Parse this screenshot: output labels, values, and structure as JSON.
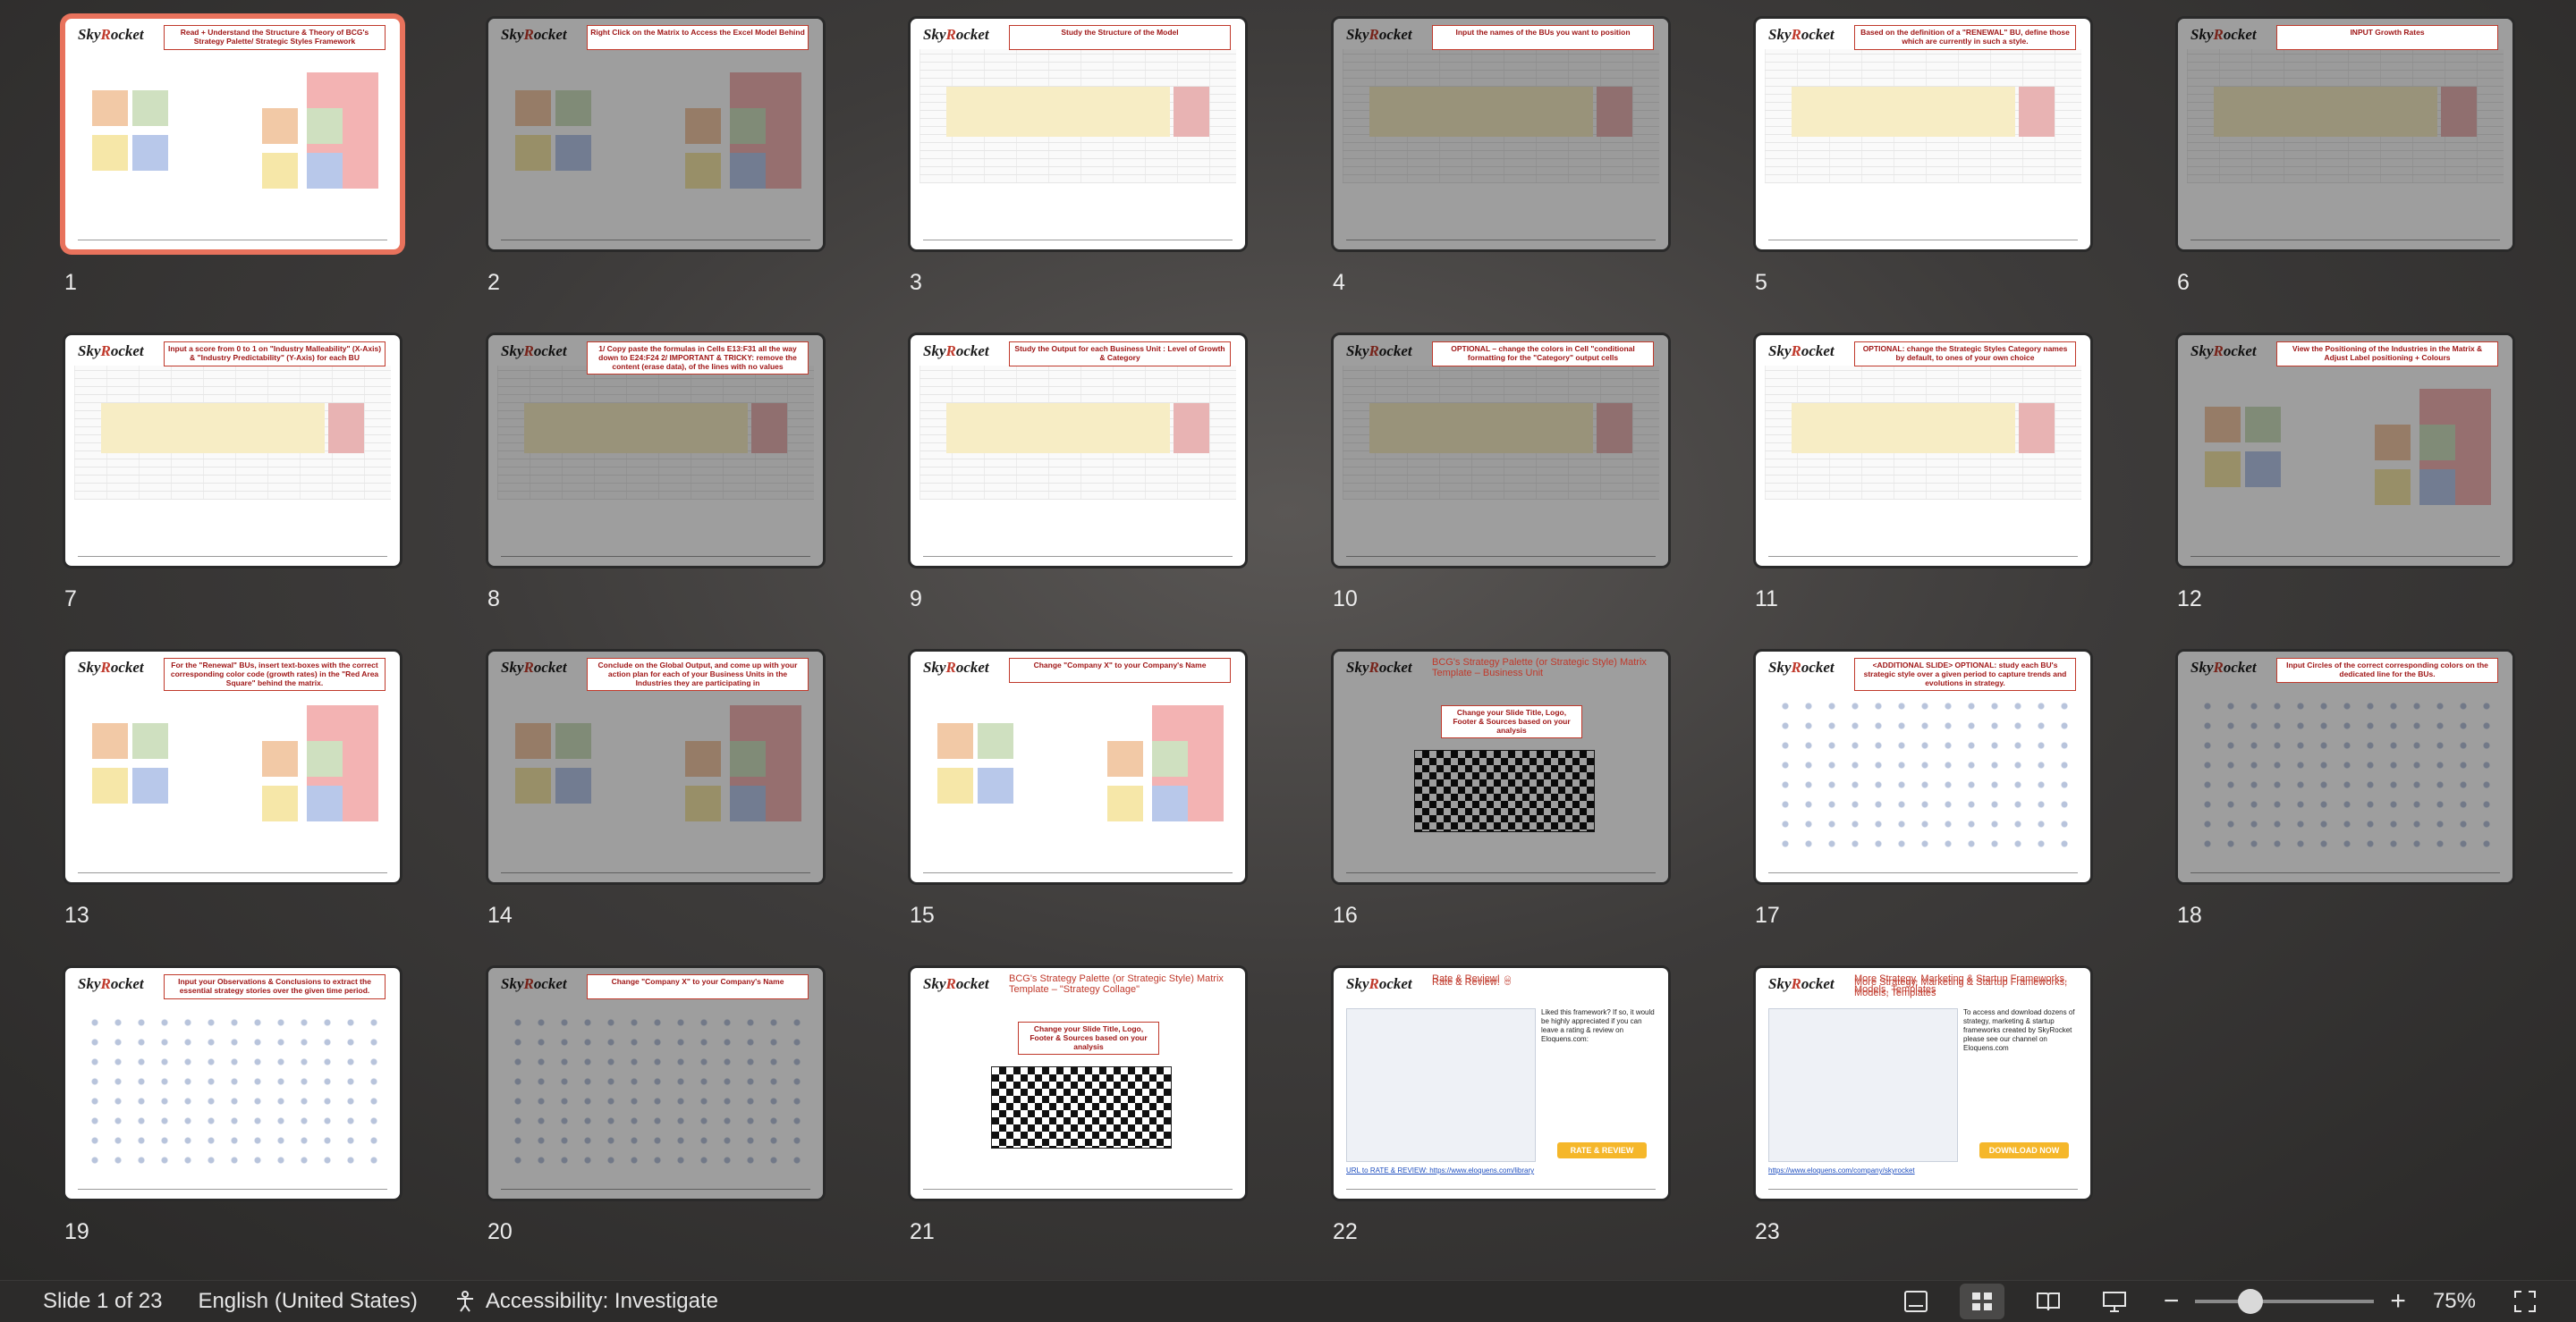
{
  "slides": [
    {
      "num": "1",
      "caption": "Read + Understand the Structure & Theory of BCG's Strategy Palette/ Strategic Styles Framework",
      "type": "matrix",
      "selected": true
    },
    {
      "num": "2",
      "caption": "Right Click on the Matrix to Access the Excel Model Behind",
      "type": "matrix"
    },
    {
      "num": "3",
      "caption": "Study the Structure of the Model",
      "type": "sheet"
    },
    {
      "num": "4",
      "caption": "Input the names of the BUs you want to position",
      "type": "sheet"
    },
    {
      "num": "5",
      "caption": "Based on the definition of a \"RENEWAL\" BU, define those which are currently in such a style.",
      "type": "sheet"
    },
    {
      "num": "6",
      "caption": "INPUT Growth Rates",
      "type": "sheet"
    },
    {
      "num": "7",
      "caption": "Input a score from 0 to 1 on \"Industry Malleability\" (X-Axis) & \"Industry Predictability\" (Y-Axis) for each BU",
      "type": "sheet"
    },
    {
      "num": "8",
      "caption": "1/ Copy paste the formulas in Cells E13:F31 all the way down to E24:F24 2/ IMPORTANT & TRICKY: remove the content (erase data), of the lines with no values",
      "type": "sheet"
    },
    {
      "num": "9",
      "caption": "Study the Output for each Business Unit : Level of Growth & Category",
      "type": "sheet"
    },
    {
      "num": "10",
      "caption": "OPTIONAL – change the colors in Cell \"conditional formatting for the \"Category\" output cells",
      "type": "sheet"
    },
    {
      "num": "11",
      "caption": "OPTIONAL: change the Strategic Styles Category names by default, to ones of your own choice",
      "type": "sheet"
    },
    {
      "num": "12",
      "caption": "View the Positioning of the Industries in the Matrix & Adjust Label positioning + Colours",
      "type": "matrix"
    },
    {
      "num": "13",
      "caption": "For the \"Renewal\" BUs, insert text-boxes with the correct corresponding color code (growth rates) in the \"Red Area Square\" behind the matrix.",
      "type": "matrix"
    },
    {
      "num": "14",
      "caption": "Conclude on the Global Output, and come up with your action plan for each of your Business Units in the Industries they are participating in",
      "type": "matrix"
    },
    {
      "num": "15",
      "caption": "Change \"Company X\" to your Company's Name",
      "type": "matrix"
    },
    {
      "num": "16",
      "caption": "Change your Slide Title, Logo, Footer & Sources based on your analysis",
      "type": "flag",
      "title": "BCG's Strategy Palette (or Strategic Style) Matrix Template – Business Unit"
    },
    {
      "num": "17",
      "caption": "<ADDITIONAL SLIDE> OPTIONAL: study each BU's strategic style over a given period to capture trends and evolutions in strategy.",
      "type": "dots"
    },
    {
      "num": "18",
      "caption": "Input Circles of the correct corresponding colors on the dedicated line for the BUs.",
      "type": "dots"
    },
    {
      "num": "19",
      "caption": "Input your Observations & Conclusions to extract the essential strategy stories over the given time period.",
      "type": "dots"
    },
    {
      "num": "20",
      "caption": "Change \"Company X\" to your Company's Name",
      "type": "dots"
    },
    {
      "num": "21",
      "caption": "Change your Slide Title, Logo, Footer & Sources based on your analysis",
      "type": "flag",
      "title": "BCG's Strategy Palette (or Strategic Style) Matrix Template – \"Strategy Collage\""
    },
    {
      "num": "22",
      "caption": "",
      "type": "review",
      "title": "Rate & Review! ☺",
      "body": "Liked this framework? If so, it would be highly appreciated if you can leave a rating & review on Eloquens.com:",
      "cta": "RATE & REVIEW",
      "link": "URL to RATE & REVIEW: https://www.eloquens.com/library"
    },
    {
      "num": "23",
      "caption": "",
      "type": "more",
      "title": "More Strategy, Marketing & Startup Frameworks, Models, Templates",
      "body": "To access and download dozens of strategy, marketing & startup frameworks created by SkyRocket please see our channel on Eloquens.com",
      "cta": "DOWNLOAD NOW",
      "link": "https://www.eloquens.com/company/skyrocket"
    }
  ],
  "logo": {
    "prefix": "Sky",
    "accent": "R",
    "suffix": "ocket"
  },
  "status": {
    "slide_indicator": "Slide 1 of 23",
    "language": "English (United States)",
    "accessibility": "Accessibility: Investigate",
    "zoom": "75%"
  },
  "zoom_level": 0.31
}
